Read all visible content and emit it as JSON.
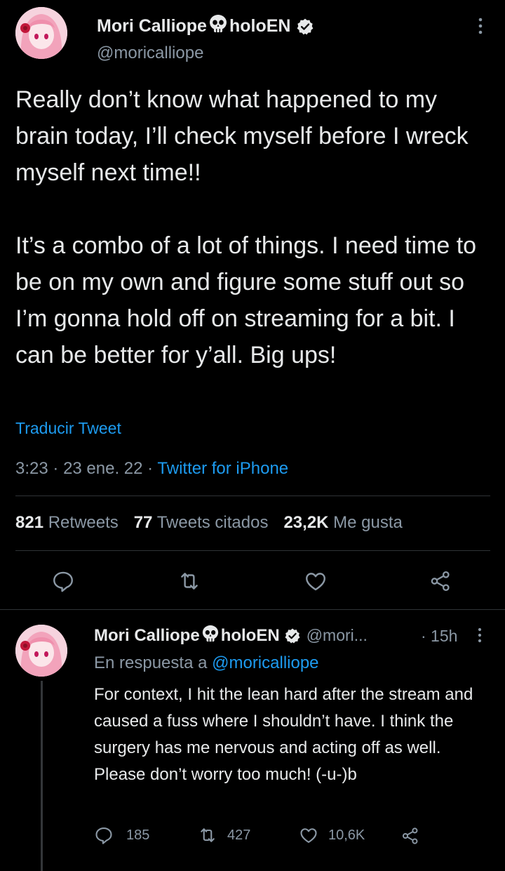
{
  "main_tweet": {
    "author_name": "Mori Calliope",
    "author_suffix": "holoEN",
    "handle": "@moricalliope",
    "text": "Really don’t know what happened to my brain today, I’ll check myself before I wreck myself next time!!\n\nIt’s a combo of a lot of things. I need time to be on my own and figure some stuff out so I’m gonna hold off on streaming for a bit. I can be better for y’all. Big ups!",
    "translate_label": "Traducir Tweet",
    "time": "3:23",
    "date": "23 ene. 22",
    "source": "Twitter for iPhone",
    "retweets_count": "821",
    "retweets_label": "Retweets",
    "quotes_count": "77",
    "quotes_label": "Tweets citados",
    "likes_count": "23,2K",
    "likes_label": "Me gusta"
  },
  "reply_tweet": {
    "author_name": "Mori Calliope",
    "author_suffix": "holoEN",
    "handle": "@mori...",
    "time": "· 15h",
    "reply_to_prefix": "En respuesta a",
    "reply_to_handle": "@moricalliope",
    "text": "For context, I hit the lean hard after the stream and caused a fuss where I shouldn’t have. I think the surgery has me nervous and acting off as well. Please don’t worry too much! (-u-)b",
    "replies": "185",
    "retweets": "427",
    "likes": "10,6K"
  },
  "colors": {
    "background": "#000000",
    "text": "#e7e9ea",
    "secondary": "#8b98a5",
    "link": "#1d9bf0",
    "divider": "#2f3336"
  }
}
